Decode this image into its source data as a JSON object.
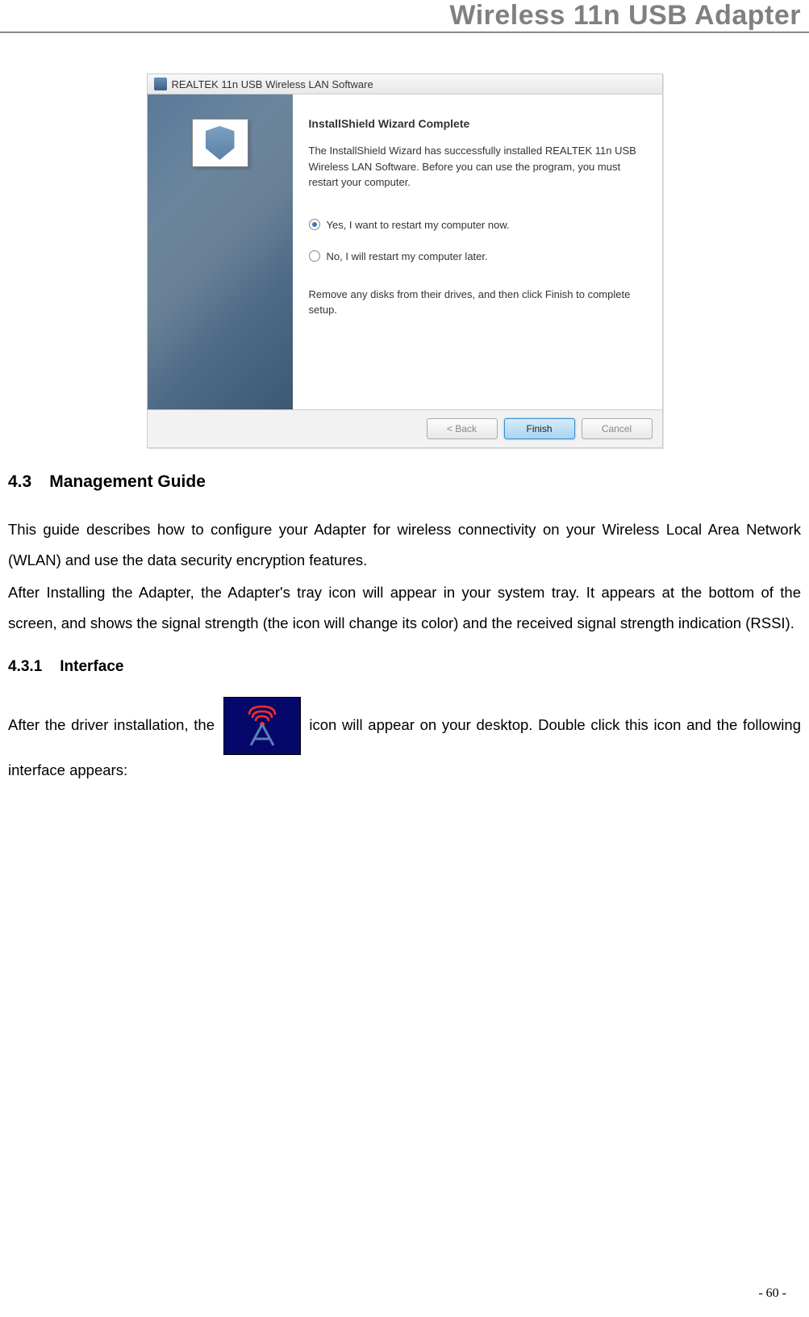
{
  "header": {
    "title": "Wireless 11n USB Adapter"
  },
  "dialog": {
    "titlebar": "REALTEK 11n USB Wireless LAN Software",
    "wizard_title": "InstallShield Wizard Complete",
    "wizard_desc": "The InstallShield Wizard has successfully installed REALTEK 11n USB Wireless LAN Software.  Before you can use the program, you must restart your computer.",
    "radio_yes": "Yes, I want to restart my computer now.",
    "radio_no": "No, I will restart my computer later.",
    "remove_note": "Remove any disks from their drives, and then click Finish to complete setup.",
    "buttons": {
      "back": "< Back",
      "finish": "Finish",
      "cancel": "Cancel"
    }
  },
  "section_4_3": {
    "number": "4.3",
    "title": "Management Guide",
    "para1": "This guide describes how to configure your Adapter for wireless connectivity on your Wireless Local Area Network (WLAN) and use the data security encryption features.",
    "para2": "After Installing the Adapter, the Adapter's tray icon will appear in your system tray. It appears at the bottom of the screen, and shows the signal strength (the icon will change its color) and the received signal strength indication (RSSI)."
  },
  "section_4_3_1": {
    "number": "4.3.1",
    "title": "Interface",
    "text_before": "After the driver installation, the ",
    "text_after": " icon will appear on your desktop. Double click this icon and the following interface appears:"
  },
  "page_number": "- 60 -"
}
